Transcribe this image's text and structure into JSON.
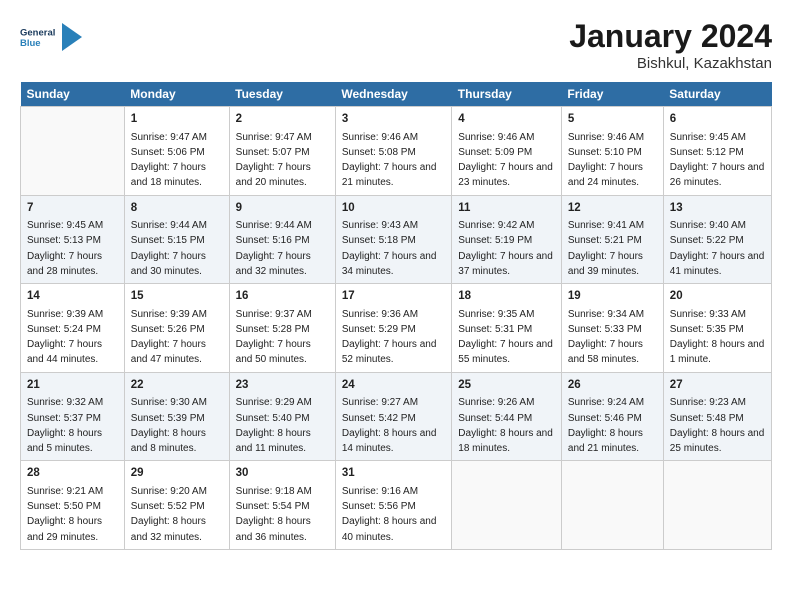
{
  "logo": {
    "line1": "General",
    "line2": "Blue"
  },
  "title": "January 2024",
  "subtitle": "Bishkul, Kazakhstan",
  "days_of_week": [
    "Sunday",
    "Monday",
    "Tuesday",
    "Wednesday",
    "Thursday",
    "Friday",
    "Saturday"
  ],
  "weeks": [
    [
      {
        "day": "",
        "sunrise": "",
        "sunset": "",
        "daylight": ""
      },
      {
        "day": "1",
        "sunrise": "Sunrise: 9:47 AM",
        "sunset": "Sunset: 5:06 PM",
        "daylight": "Daylight: 7 hours and 18 minutes."
      },
      {
        "day": "2",
        "sunrise": "Sunrise: 9:47 AM",
        "sunset": "Sunset: 5:07 PM",
        "daylight": "Daylight: 7 hours and 20 minutes."
      },
      {
        "day": "3",
        "sunrise": "Sunrise: 9:46 AM",
        "sunset": "Sunset: 5:08 PM",
        "daylight": "Daylight: 7 hours and 21 minutes."
      },
      {
        "day": "4",
        "sunrise": "Sunrise: 9:46 AM",
        "sunset": "Sunset: 5:09 PM",
        "daylight": "Daylight: 7 hours and 23 minutes."
      },
      {
        "day": "5",
        "sunrise": "Sunrise: 9:46 AM",
        "sunset": "Sunset: 5:10 PM",
        "daylight": "Daylight: 7 hours and 24 minutes."
      },
      {
        "day": "6",
        "sunrise": "Sunrise: 9:45 AM",
        "sunset": "Sunset: 5:12 PM",
        "daylight": "Daylight: 7 hours and 26 minutes."
      }
    ],
    [
      {
        "day": "7",
        "sunrise": "Sunrise: 9:45 AM",
        "sunset": "Sunset: 5:13 PM",
        "daylight": "Daylight: 7 hours and 28 minutes."
      },
      {
        "day": "8",
        "sunrise": "Sunrise: 9:44 AM",
        "sunset": "Sunset: 5:15 PM",
        "daylight": "Daylight: 7 hours and 30 minutes."
      },
      {
        "day": "9",
        "sunrise": "Sunrise: 9:44 AM",
        "sunset": "Sunset: 5:16 PM",
        "daylight": "Daylight: 7 hours and 32 minutes."
      },
      {
        "day": "10",
        "sunrise": "Sunrise: 9:43 AM",
        "sunset": "Sunset: 5:18 PM",
        "daylight": "Daylight: 7 hours and 34 minutes."
      },
      {
        "day": "11",
        "sunrise": "Sunrise: 9:42 AM",
        "sunset": "Sunset: 5:19 PM",
        "daylight": "Daylight: 7 hours and 37 minutes."
      },
      {
        "day": "12",
        "sunrise": "Sunrise: 9:41 AM",
        "sunset": "Sunset: 5:21 PM",
        "daylight": "Daylight: 7 hours and 39 minutes."
      },
      {
        "day": "13",
        "sunrise": "Sunrise: 9:40 AM",
        "sunset": "Sunset: 5:22 PM",
        "daylight": "Daylight: 7 hours and 41 minutes."
      }
    ],
    [
      {
        "day": "14",
        "sunrise": "Sunrise: 9:39 AM",
        "sunset": "Sunset: 5:24 PM",
        "daylight": "Daylight: 7 hours and 44 minutes."
      },
      {
        "day": "15",
        "sunrise": "Sunrise: 9:39 AM",
        "sunset": "Sunset: 5:26 PM",
        "daylight": "Daylight: 7 hours and 47 minutes."
      },
      {
        "day": "16",
        "sunrise": "Sunrise: 9:37 AM",
        "sunset": "Sunset: 5:28 PM",
        "daylight": "Daylight: 7 hours and 50 minutes."
      },
      {
        "day": "17",
        "sunrise": "Sunrise: 9:36 AM",
        "sunset": "Sunset: 5:29 PM",
        "daylight": "Daylight: 7 hours and 52 minutes."
      },
      {
        "day": "18",
        "sunrise": "Sunrise: 9:35 AM",
        "sunset": "Sunset: 5:31 PM",
        "daylight": "Daylight: 7 hours and 55 minutes."
      },
      {
        "day": "19",
        "sunrise": "Sunrise: 9:34 AM",
        "sunset": "Sunset: 5:33 PM",
        "daylight": "Daylight: 7 hours and 58 minutes."
      },
      {
        "day": "20",
        "sunrise": "Sunrise: 9:33 AM",
        "sunset": "Sunset: 5:35 PM",
        "daylight": "Daylight: 8 hours and 1 minute."
      }
    ],
    [
      {
        "day": "21",
        "sunrise": "Sunrise: 9:32 AM",
        "sunset": "Sunset: 5:37 PM",
        "daylight": "Daylight: 8 hours and 5 minutes."
      },
      {
        "day": "22",
        "sunrise": "Sunrise: 9:30 AM",
        "sunset": "Sunset: 5:39 PM",
        "daylight": "Daylight: 8 hours and 8 minutes."
      },
      {
        "day": "23",
        "sunrise": "Sunrise: 9:29 AM",
        "sunset": "Sunset: 5:40 PM",
        "daylight": "Daylight: 8 hours and 11 minutes."
      },
      {
        "day": "24",
        "sunrise": "Sunrise: 9:27 AM",
        "sunset": "Sunset: 5:42 PM",
        "daylight": "Daylight: 8 hours and 14 minutes."
      },
      {
        "day": "25",
        "sunrise": "Sunrise: 9:26 AM",
        "sunset": "Sunset: 5:44 PM",
        "daylight": "Daylight: 8 hours and 18 minutes."
      },
      {
        "day": "26",
        "sunrise": "Sunrise: 9:24 AM",
        "sunset": "Sunset: 5:46 PM",
        "daylight": "Daylight: 8 hours and 21 minutes."
      },
      {
        "day": "27",
        "sunrise": "Sunrise: 9:23 AM",
        "sunset": "Sunset: 5:48 PM",
        "daylight": "Daylight: 8 hours and 25 minutes."
      }
    ],
    [
      {
        "day": "28",
        "sunrise": "Sunrise: 9:21 AM",
        "sunset": "Sunset: 5:50 PM",
        "daylight": "Daylight: 8 hours and 29 minutes."
      },
      {
        "day": "29",
        "sunrise": "Sunrise: 9:20 AM",
        "sunset": "Sunset: 5:52 PM",
        "daylight": "Daylight: 8 hours and 32 minutes."
      },
      {
        "day": "30",
        "sunrise": "Sunrise: 9:18 AM",
        "sunset": "Sunset: 5:54 PM",
        "daylight": "Daylight: 8 hours and 36 minutes."
      },
      {
        "day": "31",
        "sunrise": "Sunrise: 9:16 AM",
        "sunset": "Sunset: 5:56 PM",
        "daylight": "Daylight: 8 hours and 40 minutes."
      },
      {
        "day": "",
        "sunrise": "",
        "sunset": "",
        "daylight": ""
      },
      {
        "day": "",
        "sunrise": "",
        "sunset": "",
        "daylight": ""
      },
      {
        "day": "",
        "sunrise": "",
        "sunset": "",
        "daylight": ""
      }
    ]
  ]
}
